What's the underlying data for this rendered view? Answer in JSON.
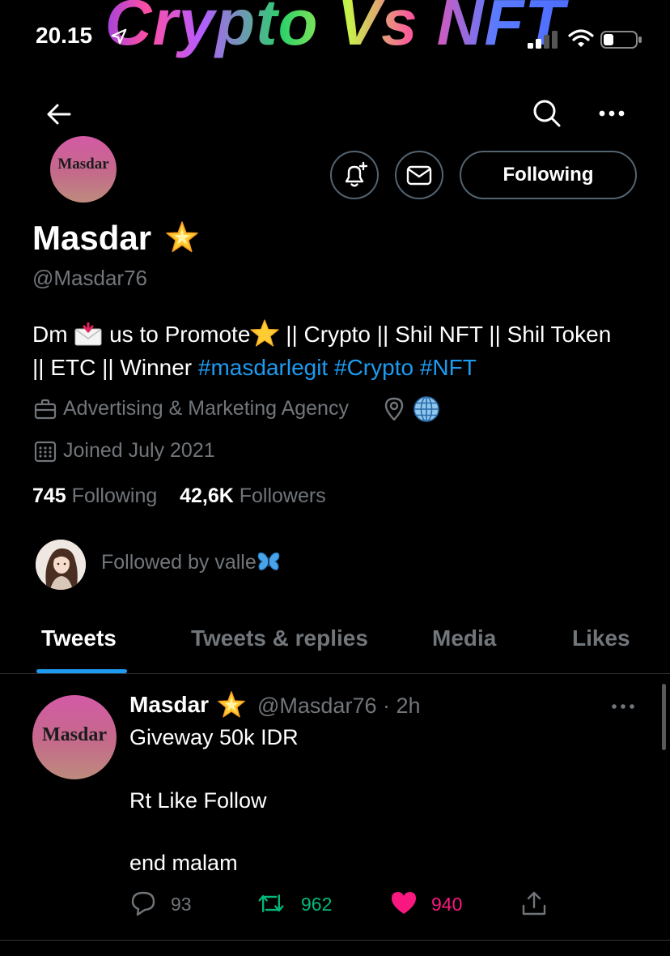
{
  "overlay_title": "Crypto Vs NFT",
  "status_bar": {
    "time": "20.15"
  },
  "profile": {
    "avatar_text": "Masdar",
    "name": "Masdar",
    "handle": "@Masdar76",
    "follow_button_label": "Following",
    "bio": {
      "part1": "Dm ",
      "part2": " us to Promote",
      "part3": " || Crypto || Shil NFT || Shil Token || ETC || Winner ",
      "hashtags": [
        "#masdarlegit",
        "#Crypto",
        "#NFT"
      ]
    },
    "profession": "Advertising & Marketing Agency",
    "joined": "Joined July 2021",
    "following_count": "745",
    "following_label": "Following",
    "followers_count": "42,6K",
    "followers_label": "Followers",
    "followed_by": "Followed by valle"
  },
  "tabs": [
    {
      "label": "Tweets",
      "active": true
    },
    {
      "label": "Tweets & replies",
      "active": false
    },
    {
      "label": "Media",
      "active": false
    },
    {
      "label": "Likes",
      "active": false
    }
  ],
  "tweet": {
    "avatar_text": "Masdar",
    "name": "Masdar",
    "handle_time": "@Masdar76 · 2h",
    "lines": [
      "Giveway 50k IDR",
      "Rt Like Follow",
      "end malam"
    ],
    "replies": "93",
    "retweets": "962",
    "likes": "940"
  },
  "colors": {
    "accent": "#1d9bf0",
    "retweet": "#00ba7c",
    "like": "#f91880",
    "muted": "#71767b"
  }
}
